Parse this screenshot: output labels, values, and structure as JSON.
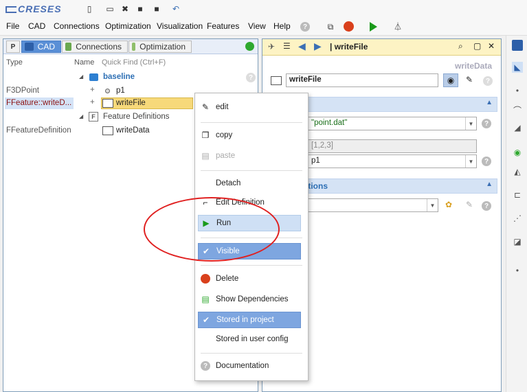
{
  "app": {
    "logo": "CRESES"
  },
  "menubar": [
    {
      "label": "File"
    },
    {
      "label": "CAD"
    },
    {
      "label": "Connections"
    },
    {
      "label": "Optimization"
    },
    {
      "label": "Visualization"
    },
    {
      "label": "Features"
    },
    {
      "label": "View"
    },
    {
      "label": "Help"
    }
  ],
  "left_panel": {
    "tabs": [
      {
        "label": "P"
      },
      {
        "label": "CAD"
      },
      {
        "label": "Connections"
      },
      {
        "label": "Optimization"
      }
    ],
    "columns": {
      "type": "Type",
      "name": "Name",
      "quickfind": "Quick Find (Ctrl+F)"
    },
    "tree": [
      {
        "type": "",
        "name": "baseline"
      },
      {
        "type": "F3DPoint",
        "name": "p1"
      },
      {
        "type": "FFeature::writeD...",
        "name": "writeFile"
      },
      {
        "type": "",
        "name": "Feature Definitions"
      },
      {
        "type": "FFeatureDefinition",
        "name": "writeData"
      }
    ]
  },
  "right_panel": {
    "title": "| writeFile",
    "subtitle": "writeData",
    "name_field": "writeFile",
    "section1_label": "",
    "fields": [
      {
        "value": "\"point.dat\""
      },
      {
        "value": "[1,2,3]"
      },
      {
        "value": "p1"
      }
    ],
    "section2_label": "ptions"
  },
  "context_menu": {
    "items": [
      {
        "label": "edit"
      },
      {
        "label": "copy"
      },
      {
        "label": "paste"
      },
      {
        "label": "Detach"
      },
      {
        "label": "Edit Definition"
      },
      {
        "label": "Run"
      },
      {
        "label": "Visible"
      },
      {
        "label": "Delete"
      },
      {
        "label": "Show Dependencies"
      },
      {
        "label": "Stored in project"
      },
      {
        "label": "Stored in user config"
      },
      {
        "label": "Documentation"
      }
    ]
  },
  "colors": {
    "accent": "#5a8fd6",
    "run_green": "#1a9a1a",
    "annotation_red": "#e02020",
    "type_red": "#8a1010"
  }
}
